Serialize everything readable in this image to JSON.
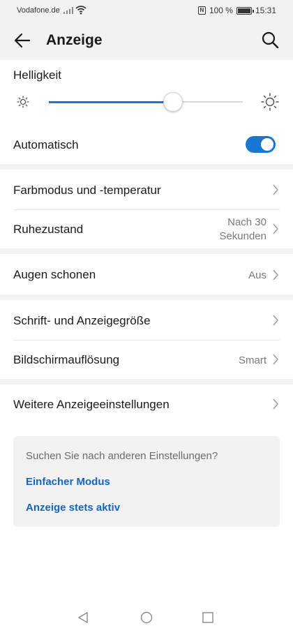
{
  "status_bar": {
    "carrier": "Vodafone.de",
    "battery": "100 %",
    "time": "15:31",
    "icons": [
      "signal-icon",
      "wifi-icon",
      "nfc-icon",
      "battery-icon"
    ]
  },
  "app_bar": {
    "title": "Anzeige",
    "back_icon": "arrow-left-icon",
    "search_icon": "search-icon"
  },
  "brightness": {
    "label": "Helligkeit",
    "level_fraction": 0.64,
    "min_icon": "sun-small-icon",
    "max_icon": "sun-large-icon"
  },
  "automatic": {
    "label": "Automatisch",
    "enabled": true
  },
  "rows": {
    "color_mode": {
      "label": "Farbmodus und -temperatur"
    },
    "sleep": {
      "label": "Ruhezustand",
      "value_line1": "Nach 30",
      "value_line2": "Sekunden"
    },
    "eye_comfort": {
      "label": "Augen schonen",
      "value": "Aus"
    },
    "text_size": {
      "label": "Schrift- und Anzeigegröße"
    },
    "resolution": {
      "label": "Bildschirmauflösung",
      "value": "Smart"
    },
    "more": {
      "label": "Weitere Anzeigeeinstellungen"
    }
  },
  "suggestions": {
    "question": "Suchen Sie nach anderen Einstellungen?",
    "link1": "Einfacher Modus",
    "link2": "Anzeige stets aktiv"
  },
  "colors": {
    "accent": "#1976d2",
    "link": "#1565c0",
    "background_gray": "#f2f2f2"
  },
  "nav_bar": {
    "icons": [
      "nav-back-icon",
      "nav-home-icon",
      "nav-recents-icon"
    ]
  }
}
